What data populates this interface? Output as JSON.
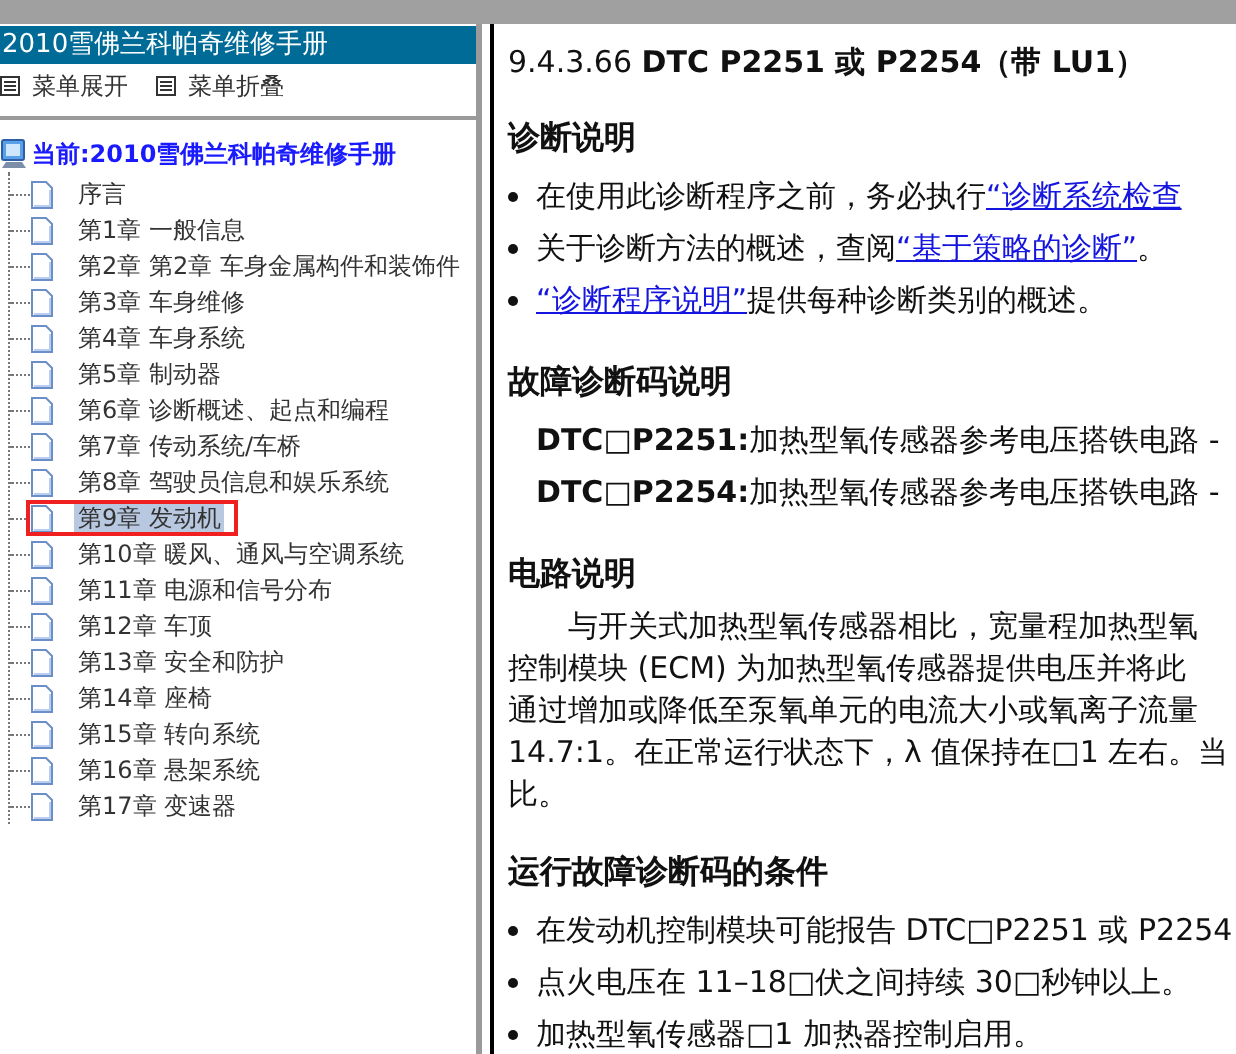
{
  "sidebar": {
    "title": "2010雪佛兰科帕奇维修手册",
    "toolbar": [
      {
        "label": "菜单展开"
      },
      {
        "label": "菜单折叠"
      }
    ],
    "tree": {
      "label": "当前:2010雪佛兰科帕奇维修手册",
      "children": [
        {
          "label": "序言",
          "selected": false,
          "circled": false
        },
        {
          "label": "第1章 一般信息",
          "selected": false,
          "circled": false
        },
        {
          "label": "第2章 第2章 车身金属构件和装饰件",
          "selected": false,
          "circled": false
        },
        {
          "label": "第3章 车身维修",
          "selected": false,
          "circled": false
        },
        {
          "label": "第4章 车身系统",
          "selected": false,
          "circled": false
        },
        {
          "label": "第5章 制动器",
          "selected": false,
          "circled": false
        },
        {
          "label": "第6章 诊断概述、起点和编程",
          "selected": false,
          "circled": false
        },
        {
          "label": "第7章 传动系统/车桥",
          "selected": false,
          "circled": false
        },
        {
          "label": "第8章 驾驶员信息和娱乐系统",
          "selected": false,
          "circled": false
        },
        {
          "label": "第9章 发动机",
          "selected": true,
          "circled": true
        },
        {
          "label": "第10章 暖风、通风与空调系统",
          "selected": false,
          "circled": false
        },
        {
          "label": "第11章 电源和信号分布",
          "selected": false,
          "circled": false
        },
        {
          "label": "第12章 车顶",
          "selected": false,
          "circled": false
        },
        {
          "label": "第13章 安全和防护",
          "selected": false,
          "circled": false
        },
        {
          "label": "第14章 座椅",
          "selected": false,
          "circled": false
        },
        {
          "label": "第15章 转向系统",
          "selected": false,
          "circled": false
        },
        {
          "label": "第16章 悬架系统",
          "selected": false,
          "circled": false
        },
        {
          "label": "第17章 变速器",
          "selected": false,
          "circled": false
        }
      ]
    }
  },
  "content": {
    "title": "9.4.3.66 **DTC P2251 或 P2254（带 LU1）**",
    "sections": [
      {
        "heading": "诊断说明",
        "blocks": [
          {
            "kind": "bullet",
            "parts": [
              {
                "kind": "text",
                "text": "在使用此诊断程序之前，务必执行"
              },
              {
                "kind": "link",
                "text": "“诊断系统检查"
              }
            ]
          },
          {
            "kind": "bullet",
            "parts": [
              {
                "kind": "text",
                "text": "关于诊断方法的概述，查阅"
              },
              {
                "kind": "link",
                "text": "“基于策略的诊断”"
              },
              {
                "kind": "text",
                "text": "。"
              }
            ]
          },
          {
            "kind": "bullet",
            "parts": [
              {
                "kind": "link",
                "text": "“诊断程序说明”"
              },
              {
                "kind": "text",
                "text": "提供每种诊断类别的概述。"
              }
            ]
          }
        ]
      },
      {
        "heading": "故障诊断码说明",
        "blocks": [
          {
            "kind": "dtc",
            "code": "DTC□P2251:",
            "text": "加热型氧传感器参考电压搭铁电路 -"
          },
          {
            "kind": "dtc",
            "code": "DTC□P2254:",
            "text": "加热型氧传感器参考电压搭铁电路 -"
          }
        ]
      },
      {
        "heading": "电路说明",
        "blocks": [
          {
            "kind": "paragraph",
            "lines": [
              "与开关式加热型氧传感器相比，宽量程加热型氧",
              "控制模块 (ECM) 为加热型氧传感器提供电压并将此",
              "通过增加或降低至泵氧单元的电流大小或氧离子流量",
              "14.7:1。在正常运行状态下，λ 值保持在□1 左右。当",
              "比。"
            ]
          }
        ]
      },
      {
        "heading": "运行故障诊断码的条件",
        "blocks": [
          {
            "kind": "bullet",
            "parts": [
              {
                "kind": "text",
                "text": "在发动机控制模块可能报告 DTC□P2251 或 P2254"
              }
            ]
          },
          {
            "kind": "bullet",
            "parts": [
              {
                "kind": "text",
                "text": "点火电压在 11–18□伏之间持续 30□秒钟以上。"
              }
            ]
          },
          {
            "kind": "bullet",
            "parts": [
              {
                "kind": "text",
                "text": "加热型氧传感器□1 加热器控制启用。"
              }
            ]
          }
        ]
      }
    ]
  }
}
